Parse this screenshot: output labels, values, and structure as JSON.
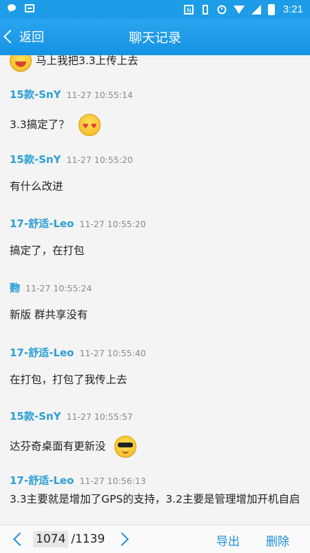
{
  "status_bar": {
    "time": "3:21",
    "icons": [
      "chat-icon",
      "inbox-icon",
      "nfc-icon",
      "vibrate-icon",
      "alarm-icon",
      "wifi-icon",
      "signal-icon",
      "battery-icon"
    ]
  },
  "header": {
    "back_label": "返回",
    "title": "聊天记录"
  },
  "messages": [
    {
      "sender": "",
      "time": "",
      "text": "马上我把3.3上传上去",
      "emoji": "grin"
    },
    {
      "sender": "15款-SnY",
      "time": "11-27 10:55:14",
      "text": "3.3搞定了？",
      "emoji": "hearts"
    },
    {
      "sender": "15款-SnY",
      "time": "11-27 10:55:20",
      "text": "有什么改进",
      "emoji": ""
    },
    {
      "sender": "17-舒适-Leo",
      "time": "11-27 10:55:20",
      "text": "搞定了，在打包",
      "emoji": ""
    },
    {
      "sender": "覅",
      "time": "11-27 10:55:24",
      "text": "新版 群共享没有",
      "emoji": ""
    },
    {
      "sender": "17-舒适-Leo",
      "time": "11-27 10:55:40",
      "text": "在打包，打包了我传上去",
      "emoji": ""
    },
    {
      "sender": "15款-SnY",
      "time": "11-27 10:55:57",
      "text": "达芬奇桌面有更新没",
      "emoji": "cool"
    },
    {
      "sender": "17-舒适-Leo",
      "time": "11-27 10:56:13",
      "text": "3.3主要就是增加了GPS的支持，3.2主要是管理增加开机自启",
      "emoji": ""
    }
  ],
  "footer": {
    "current_page": "1074",
    "total_pages": "/1139",
    "export_label": "导出",
    "delete_label": "删除"
  },
  "colors": {
    "accent": "#1d9ce7",
    "sender": "#2a9fd6",
    "timestamp": "#8a8a8a"
  }
}
